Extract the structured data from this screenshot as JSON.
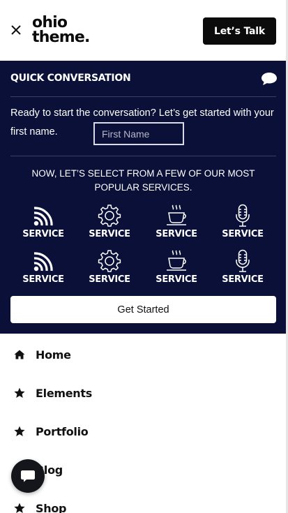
{
  "header": {
    "logo_line1": "ohio",
    "logo_line2": "theme.",
    "talk_label": "Let’s Talk"
  },
  "panel": {
    "title": "QUICK CONVERSATION",
    "intro_text": "Ready to start the conversation? Let’s get started with your first name.",
    "first_name_placeholder": "First Name",
    "first_name_value": "",
    "select_text": "Now, let’s select from a few of our most popular services.",
    "services": [
      {
        "label": "SERVICE",
        "icon": "wifi-icon"
      },
      {
        "label": "SERVICE",
        "icon": "gear-icon"
      },
      {
        "label": "SERVICE",
        "icon": "coffee-cup-icon"
      },
      {
        "label": "SERVICE",
        "icon": "microphone-icon"
      },
      {
        "label": "SERVICE",
        "icon": "wifi-icon"
      },
      {
        "label": "SERVICE",
        "icon": "gear-icon"
      },
      {
        "label": "SERVICE",
        "icon": "coffee-cup-icon"
      },
      {
        "label": "SERVICE",
        "icon": "microphone-icon"
      }
    ],
    "start_label": "Get Started"
  },
  "nav": {
    "items": [
      {
        "label": "Home",
        "icon": "home-icon"
      },
      {
        "label": "Elements",
        "icon": "star-icon"
      },
      {
        "label": "Portfolio",
        "icon": "star-icon"
      },
      {
        "label": "Blog",
        "icon": "star-icon"
      },
      {
        "label": "Shop",
        "icon": "star-icon"
      }
    ]
  },
  "colors": {
    "panel_bg": "#0a1037",
    "accent_dark": "#0b0b0b",
    "text_light": "#ffffff"
  }
}
